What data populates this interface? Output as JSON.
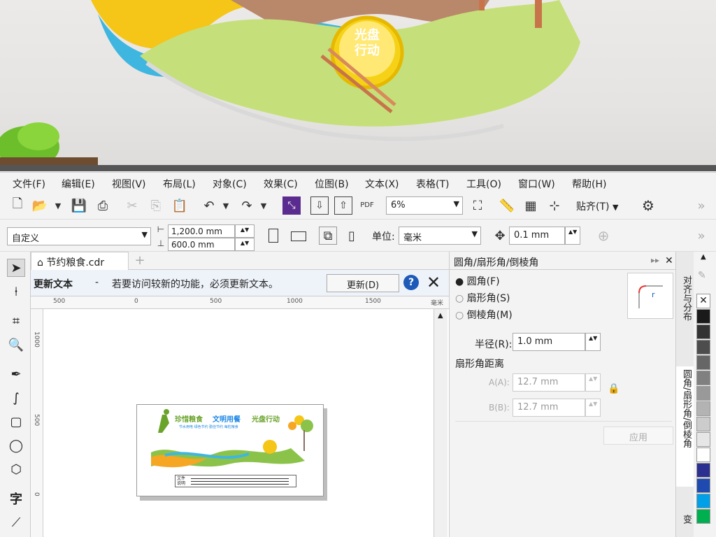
{
  "menu": [
    "文件(F)",
    "编辑(E)",
    "视图(V)",
    "布局(L)",
    "对象(C)",
    "效果(C)",
    "位图(B)",
    "文本(X)",
    "表格(T)",
    "工具(O)",
    "窗口(W)",
    "帮助(H)"
  ],
  "toolbar": {
    "zoom": "6%",
    "snap_label": "贴齐(T)",
    "pdf_label": "PDF"
  },
  "propbar": {
    "preset": "自定义",
    "width": "1,200.0 mm",
    "height": "600.0 mm",
    "units_label": "单位:",
    "units_value": "毫米",
    "nudge": "0.1 mm"
  },
  "document": {
    "tab_title": "节约粮食.cdr",
    "notice_title": "更新文本",
    "notice_dash": "-",
    "notice_text": "若要访问较新的功能，必须更新文本。",
    "update_button": "更新(D)",
    "ruler_h": [
      "500",
      "0",
      "500",
      "1000",
      "1500"
    ],
    "ruler_unit": "毫米",
    "ruler_v": [
      "1000",
      "500",
      "0"
    ]
  },
  "artwork": {
    "title1": "珍惜粮食",
    "title2": "文明用餐",
    "title3": "光盘行动",
    "line1": "节水用电 绿色节约 勤俭节约 每粒粮食",
    "caption": "文件说明"
  },
  "photo": {
    "badge_line1": "光盘",
    "badge_line2": "行动"
  },
  "panel": {
    "title": "圆角/扇形角/倒棱角",
    "options": [
      "圆角(F)",
      "扇形角(S)",
      "倒棱角(M)"
    ],
    "selected_index": 0,
    "radius_label": "半径(R):",
    "radius_value": "1.0 mm",
    "fan_distance_label": "扇形角距离",
    "a_label": "A(A):",
    "a_value": "12.7 mm",
    "b_label": "B(B):",
    "b_value": "12.7 mm",
    "apply_button": "应用"
  },
  "side_tabs": [
    "对齐与分布",
    "圆角/扇形角/倒棱角",
    "变"
  ],
  "palette": [
    "#ffffff",
    "#1a1a1a",
    "#333333",
    "#4d4d4d",
    "#666666",
    "#808080",
    "#999999",
    "#b3b3b3",
    "#cccccc",
    "#e6e6e6",
    "#ffffff",
    "#2b2f8f",
    "#1f4bb0",
    "#00a0e9",
    "#00b050"
  ],
  "colors": {
    "accent": "#2a6fdb",
    "green": "#8bc34a",
    "yellow": "#f5c518"
  }
}
